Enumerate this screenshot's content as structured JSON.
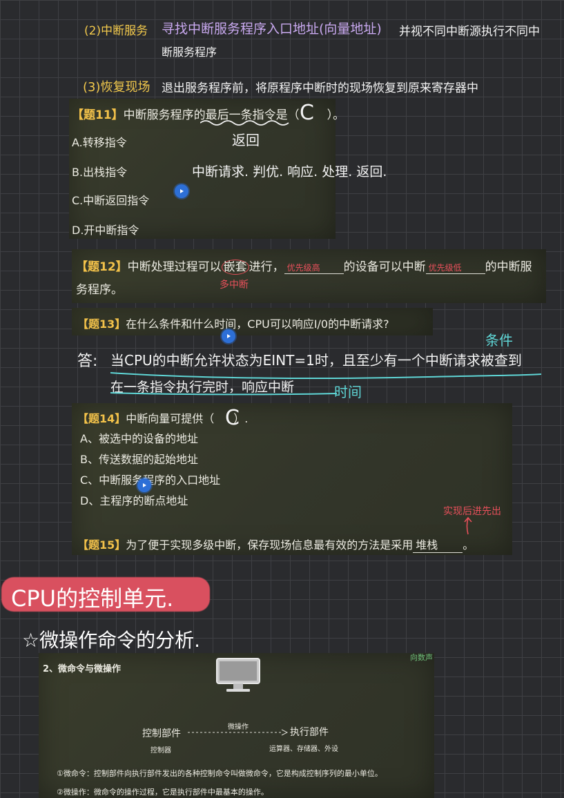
{
  "notes": {
    "step2_label": "(2)中断服务",
    "step2_text": "寻找中断服务程序入口地址(向量地址)",
    "step2_tail": "并视不同中断源执行不同中",
    "step2_line2": "断服务程序",
    "step3_label": "(3)恢复现场",
    "step3_text": "退出服务程序前，将原程序中断时的现场恢复到原来寄存器中"
  },
  "q11": {
    "number": "【题11】",
    "stem_a": "中断服务程序的",
    "stem_b": "最后一条指令",
    "stem_c": "是（",
    "stem_d": "）。",
    "answer": "C",
    "note_return": "返回",
    "note_steps": "中断请求. 判优. 响应. 处理. 返回.",
    "options": [
      "A.转移指令",
      "B.出栈指令",
      "C.中断返回指令",
      "D.开中断指令"
    ]
  },
  "q12": {
    "number": "【题12】",
    "stem_a": "中断处理过程可以",
    "circled": "嵌套",
    "stem_b": "进行，",
    "blank1": "优先级高",
    "stem_c": "的设备可以中断",
    "blank2": "优先级低",
    "stem_d": "的中断服",
    "stem_line2": "务程序。",
    "note": "多中断"
  },
  "q13": {
    "number": "【题13】",
    "stem": "在什么条件和什么时间，CPU可以响应I/0的中断请求?",
    "answer_label": "答:",
    "answer_line1": "当CPU的中断允许状态为EINT=1时，且至少有一个中断请求被查到",
    "answer_line2": "在一条指令执行完时，响应中断",
    "note_condition": "条件",
    "note_time": "时间"
  },
  "q14": {
    "number": "【题14】",
    "stem": "中断向量可提供（",
    "answer": "C",
    "stem_end": "）.",
    "options": [
      "A、被选中的设备的地址",
      "B、传送数据的起始地址",
      "C、中断服务程序的入口地址",
      "D、主程序的断点地址"
    ]
  },
  "q15": {
    "number": "【题15】",
    "stem": "为了便于实现多级中断，保存现场信息最有效的方法是采用",
    "blank": "堆栈",
    "stem_end": "。",
    "note": "实现后进先出"
  },
  "section": {
    "title": "CPU的控制单元.",
    "subtitle": "☆微操作命令的分析."
  },
  "slide": {
    "heading": "2、微命令与微操作",
    "left_block": "控制部件",
    "left_sub": "控制器",
    "arrow_label": "微操作",
    "right_block": "执行部件",
    "right_sub": "运算器、存储器、外设",
    "def1": "①微命令：控制部件向执行部件发出的各种控制命令叫做微命令，它是构成控制序列的最小单位。",
    "def2": "②微操作：微命令的操作过程，它是执行部件中最基本的操作。",
    "watermark": "向数声"
  },
  "colors": {
    "note_yellow": "#f2c94c",
    "note_purple": "#c9a9f0",
    "note_white": "#f4f4f4",
    "note_red": "#e8505b",
    "note_cyan": "#5fd6d6",
    "question_number": "#f3c24a"
  }
}
